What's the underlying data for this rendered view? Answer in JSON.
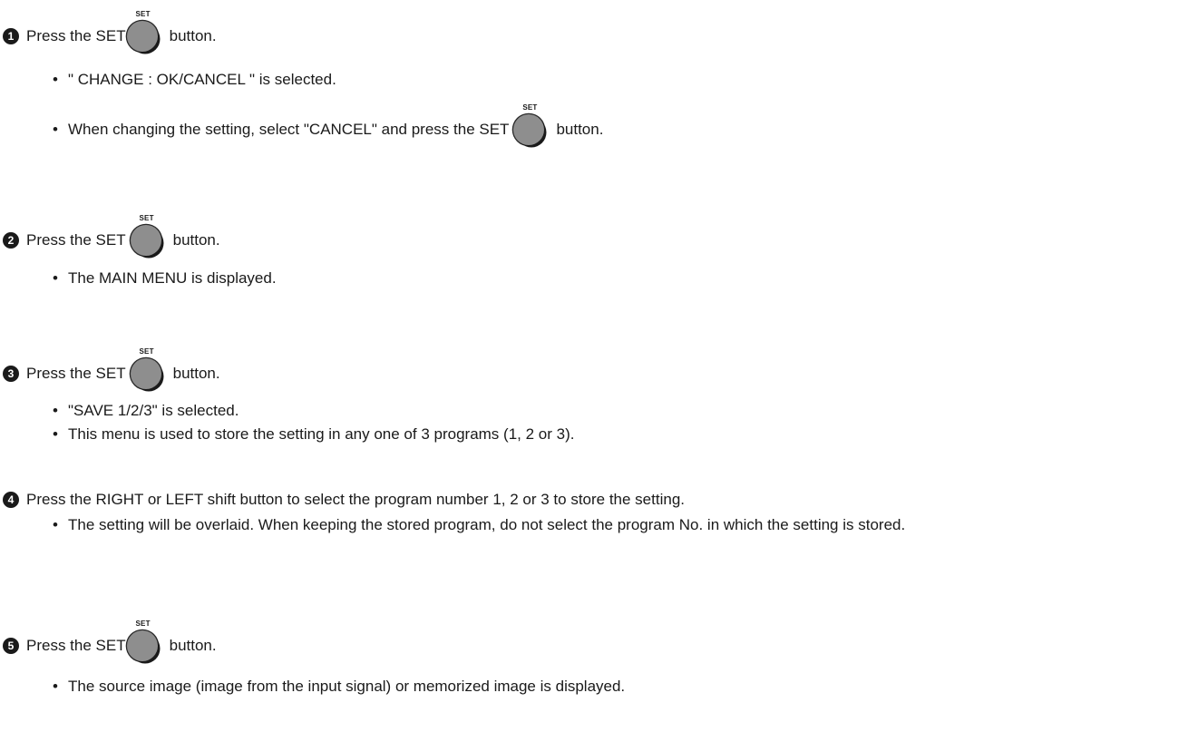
{
  "set_button": {
    "label": "SET"
  },
  "steps": [
    {
      "number": "1",
      "text_before": "Press the SET",
      "text_after": "button.",
      "bullets": [
        {
          "text": "\" CHANGE   : OK/CANCEL \" is selected."
        },
        {
          "text_before": "When changing the setting, select \"CANCEL\" and press the SET",
          "text_after": "button."
        }
      ]
    },
    {
      "number": "2",
      "text_before": "Press the SET",
      "text_after": "button.",
      "bullets": [
        {
          "text": "The MAIN MENU is displayed."
        }
      ]
    },
    {
      "number": "3",
      "text_before": "Press the SET",
      "text_after": "button.",
      "bullets": [
        {
          "text": "\"SAVE 1/2/3\" is selected."
        },
        {
          "text": "This menu is used to store the setting in any one of 3 programs (1, 2 or 3)."
        }
      ]
    },
    {
      "number": "4",
      "text": "Press the RIGHT or LEFT shift button to select the program number 1, 2 or 3 to store the setting.",
      "bullets": [
        {
          "text": "The setting will be overlaid. When keeping the stored program, do not select the program No. in which the setting is stored."
        }
      ]
    },
    {
      "number": "5",
      "text_before": "Press the SET",
      "text_after": "button.",
      "bullets": [
        {
          "text": "The source image (image from the input signal) or memorized image is displayed."
        }
      ]
    }
  ]
}
